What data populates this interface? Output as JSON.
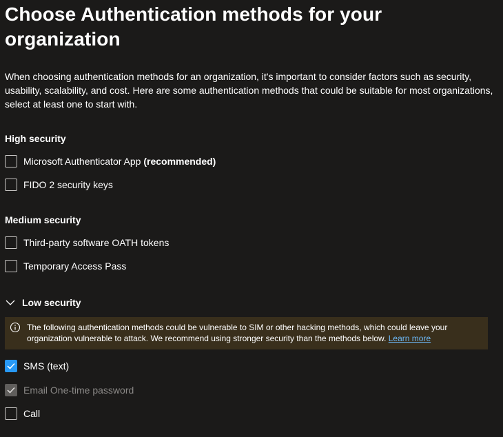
{
  "page": {
    "title": "Choose Authentication methods for your organization",
    "intro": "When choosing authentication methods for an organization, it's important to consider factors such as security, usability, scalability, and cost. Here are some authentication methods that could be suitable for most organizations, select at least one to start with."
  },
  "high_security": {
    "title": "High security",
    "options": [
      {
        "label": "Microsoft Authenticator App",
        "suffix": "(recommended)",
        "checked": false
      },
      {
        "label": "FIDO 2 security keys",
        "checked": false
      }
    ]
  },
  "medium_security": {
    "title": "Medium security",
    "options": [
      {
        "label": "Third-party software OATH tokens",
        "checked": false
      },
      {
        "label": "Temporary Access Pass",
        "checked": false
      }
    ]
  },
  "low_security": {
    "title": "Low security",
    "expanded": true,
    "warning": {
      "icon": "info-icon",
      "text": "The following authentication methods could be vulnerable to SIM or other hacking methods, which could leave your organization vulnerable to attack. We recommend using stronger security than the methods below.",
      "link": "Learn more"
    },
    "options": [
      {
        "label": "SMS (text)",
        "checked": true,
        "disabled": false
      },
      {
        "label": "Email One-time password",
        "checked": true,
        "disabled": true
      },
      {
        "label": "Call",
        "checked": false,
        "disabled": false
      }
    ]
  },
  "colors": {
    "background": "#1b1a19",
    "accent": "#2899f5",
    "warning_bg": "#392f1c",
    "link": "#6cb8f6",
    "disabled_text": "#8a8886"
  }
}
